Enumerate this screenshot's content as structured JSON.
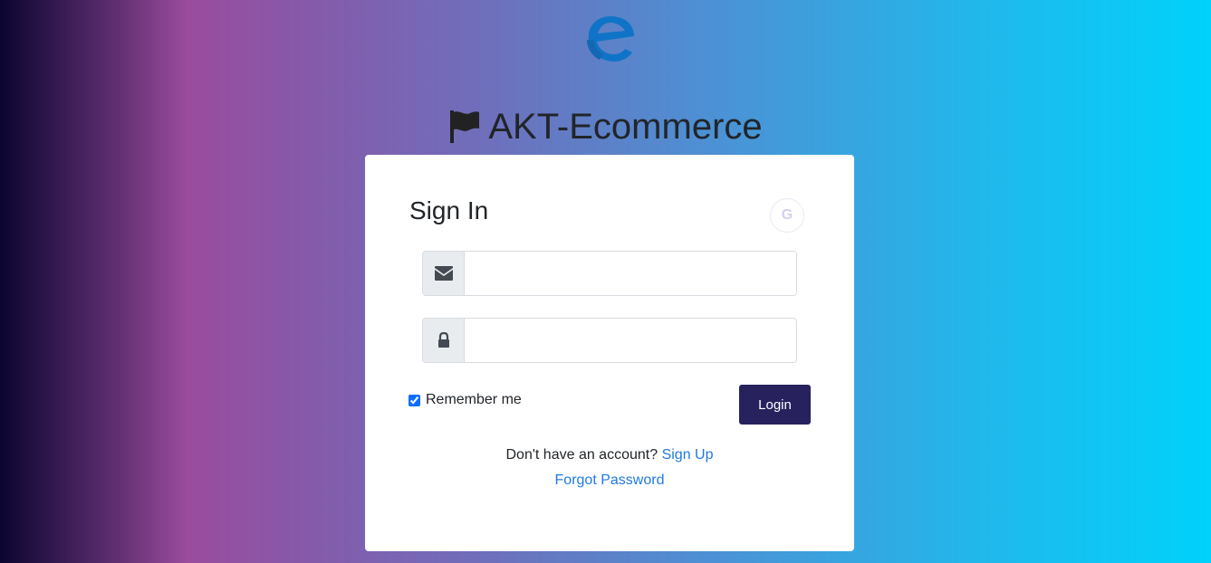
{
  "brand": {
    "title": "AKT-Ecommerce",
    "flag_icon": "flag-icon",
    "logo_icon": "e-logo-icon",
    "logo_color": "#0f74c7"
  },
  "signin": {
    "title": "Sign In",
    "google_icon_label": "G",
    "email": {
      "value": "",
      "placeholder": "",
      "icon": "envelope-icon"
    },
    "password": {
      "value": "",
      "placeholder": "",
      "icon": "lock-icon"
    },
    "remember_label": "Remember me",
    "remember_checked": true,
    "login_label": "Login",
    "no_account_text": "Don't have an account?",
    "signup_label": "Sign Up",
    "forgot_label": "Forgot Password"
  },
  "colors": {
    "login_button": "#27225e",
    "link": "#1f7ae0",
    "gradient_start": "#0b0530",
    "gradient_end": "#00d2fb"
  }
}
